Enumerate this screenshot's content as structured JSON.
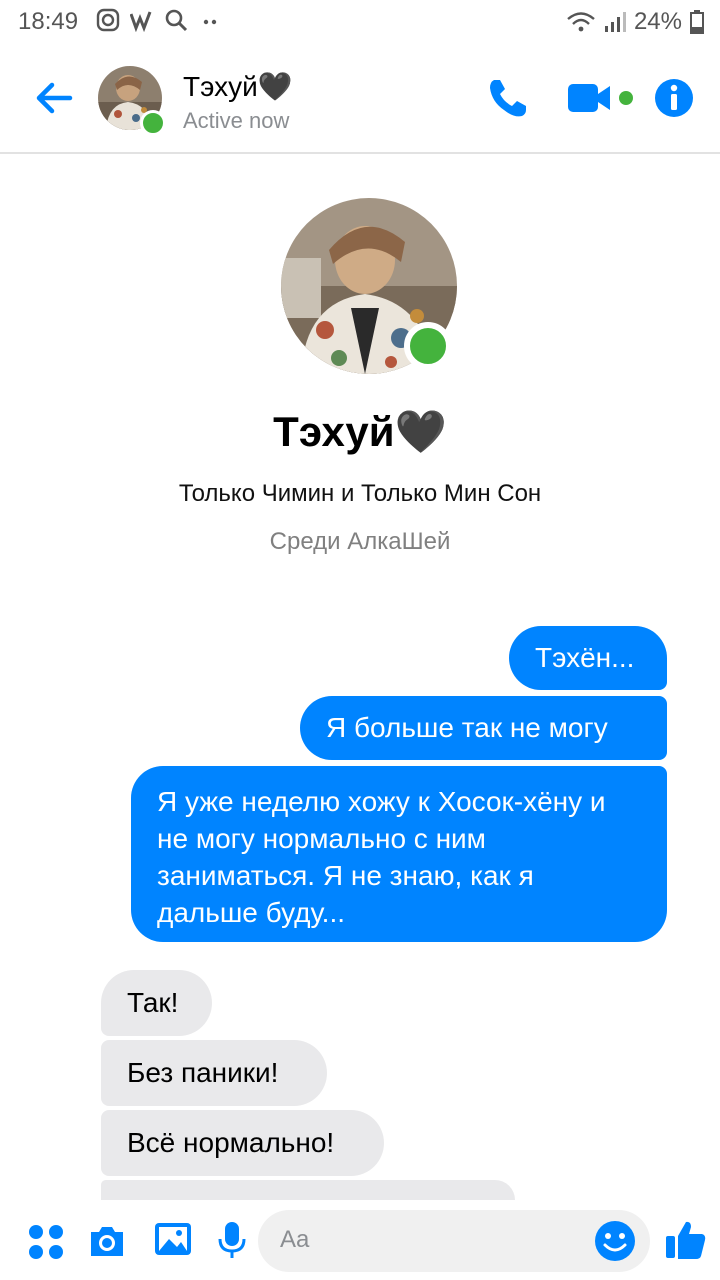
{
  "status_bar": {
    "time": "18:49",
    "battery": "24%"
  },
  "header": {
    "contact_name": "Тэхуй🖤",
    "status": "Active now"
  },
  "profile": {
    "name": "Тэхуй🖤",
    "line1": "Только Чимин и Только Мин Сон",
    "line2": "Среди АлкаШей"
  },
  "messages": [
    {
      "dir": "out",
      "text": "Тэхён..."
    },
    {
      "dir": "out",
      "text": "Я больше так не могу"
    },
    {
      "dir": "out",
      "text": "Я уже неделю хожу к Хосок-хёну и не могу нормально с ним заниматься. Я не знаю, как я дальше буду..."
    },
    {
      "dir": "in",
      "text": "Так!"
    },
    {
      "dir": "in",
      "text": "Без паники!"
    },
    {
      "dir": "in",
      "text": "Всё нормально!"
    }
  ],
  "composer": {
    "placeholder": "Aa"
  },
  "colors": {
    "accent": "#0084ff",
    "online": "#44b33d",
    "incoming_bubble": "#e9e9eb"
  },
  "icons": [
    "back-arrow-icon",
    "phone-icon",
    "video-camera-icon",
    "info-icon",
    "apps-icon",
    "camera-icon",
    "image-icon",
    "microphone-icon",
    "emoji-icon",
    "thumbs-up-icon"
  ]
}
